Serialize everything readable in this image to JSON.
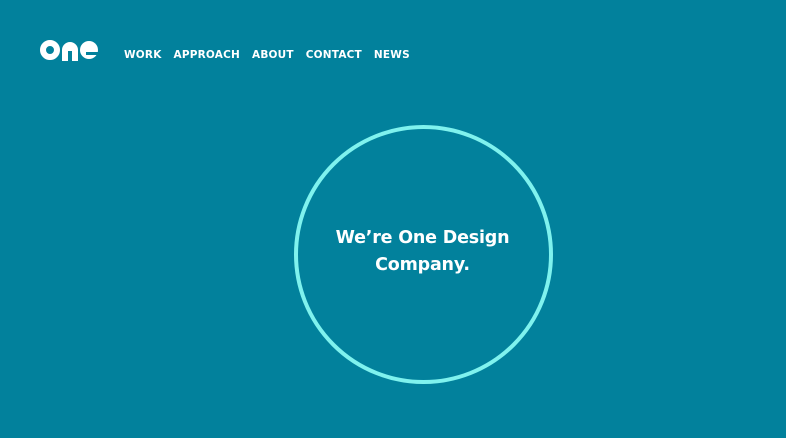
{
  "brand": {
    "logo_text": "one"
  },
  "nav": {
    "items": [
      {
        "label": "WORK"
      },
      {
        "label": "APPROACH"
      },
      {
        "label": "ABOUT"
      },
      {
        "label": "CONTACT"
      },
      {
        "label": "NEWS"
      }
    ]
  },
  "hero": {
    "headline": "We’re One Design Company."
  },
  "colors": {
    "background": "#02819c",
    "ring": "#7ff2ee",
    "text": "#ffffff"
  }
}
